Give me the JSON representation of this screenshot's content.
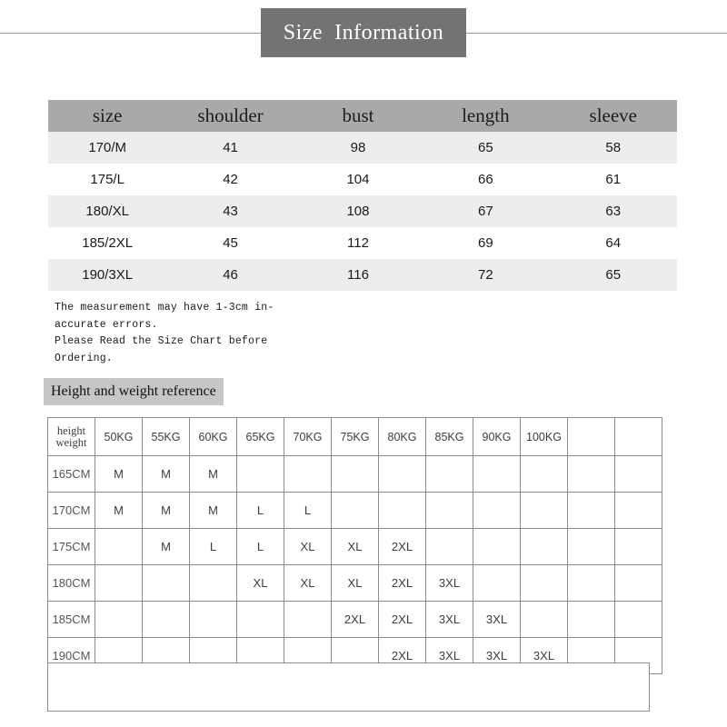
{
  "header": {
    "title": "Size  Information"
  },
  "size_table": {
    "columns": [
      "size",
      "shoulder",
      "bust",
      "length",
      "sleeve"
    ],
    "rows": [
      {
        "size": "170/M",
        "shoulder": "41",
        "bust": "98",
        "length": "65",
        "sleeve": "58"
      },
      {
        "size": "175/L",
        "shoulder": "42",
        "bust": "104",
        "length": "66",
        "sleeve": "61"
      },
      {
        "size": "180/XL",
        "shoulder": "43",
        "bust": "108",
        "length": "67",
        "sleeve": "63"
      },
      {
        "size": "185/2XL",
        "shoulder": "45",
        "bust": "112",
        "length": "69",
        "sleeve": "64"
      },
      {
        "size": "190/3XL",
        "shoulder": "46",
        "bust": "116",
        "length": "72",
        "sleeve": "65"
      }
    ]
  },
  "note": {
    "lines": [
      "The measurement may have 1-3cm in-",
      "accurate errors.",
      "Please Read the Size Chart before",
      "Ordering."
    ]
  },
  "reference": {
    "label": "Height and weight reference",
    "corner_top": "height",
    "corner_bottom": "weight",
    "weights": [
      "50KG",
      "55KG",
      "60KG",
      "65KG",
      "70KG",
      "75KG",
      "80KG",
      "85KG",
      "90KG",
      "100KG",
      "",
      ""
    ],
    "heights": [
      "165CM",
      "170CM",
      "175CM",
      "180CM",
      "185CM",
      "190CM"
    ],
    "cells": [
      [
        "M",
        "M",
        "M",
        "",
        "",
        "",
        "",
        "",
        "",
        "",
        "",
        ""
      ],
      [
        "M",
        "M",
        "M",
        "L",
        "L",
        "",
        "",
        "",
        "",
        "",
        "",
        ""
      ],
      [
        "",
        "M",
        "L",
        "L",
        "XL",
        "XL",
        "2XL",
        "",
        "",
        "",
        "",
        ""
      ],
      [
        "",
        "",
        "",
        "XL",
        "XL",
        "XL",
        "2XL",
        "3XL",
        "",
        "",
        "",
        ""
      ],
      [
        "",
        "",
        "",
        "",
        "",
        "2XL",
        "2XL",
        "3XL",
        "3XL",
        "",
        "",
        ""
      ],
      [
        "",
        "",
        "",
        "",
        "",
        "",
        "2XL",
        "3XL",
        "3XL",
        "3XL",
        "",
        ""
      ]
    ]
  },
  "colors": {
    "title_bg": "#737373",
    "header_bg": "#a9a9a9",
    "row_alt_bg": "#ededed",
    "label_bg": "#c6c6c6",
    "size_M": "#e4e4e4",
    "size_L": "#c6c6c6",
    "size_XL": "#a8a8a8",
    "size_2XL": "#5a5a5a",
    "size_3XL": "#3a3a3a",
    "grid_line": "#8c8c8c"
  }
}
